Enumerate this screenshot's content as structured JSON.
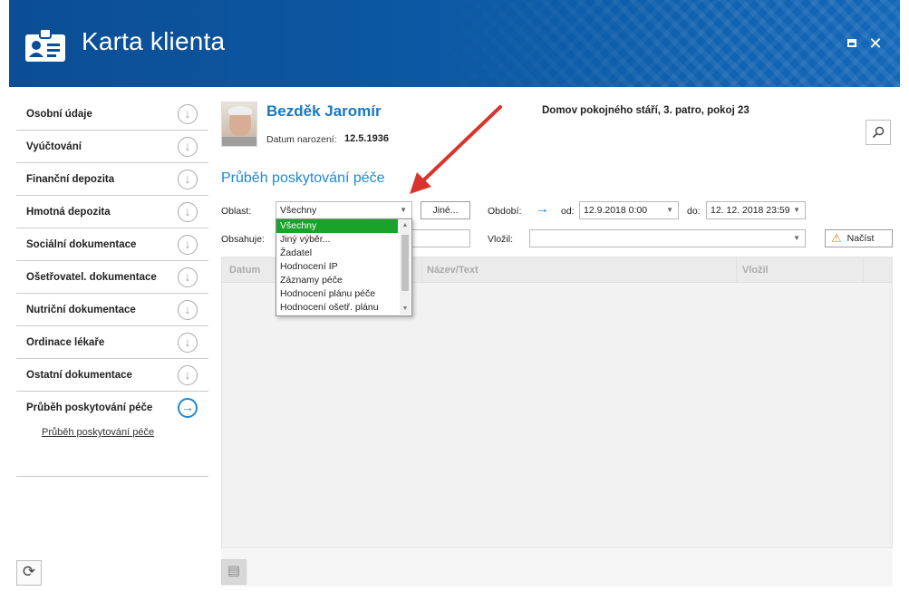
{
  "header": {
    "title": "Karta klienta",
    "bg_color": "#0b4e95"
  },
  "sidebar": {
    "items": [
      {
        "label": "Osobní údaje",
        "icon": "arrow-down-circle-icon"
      },
      {
        "label": "Vyúčtování",
        "icon": "arrow-down-circle-icon"
      },
      {
        "label": "Finanční depozita",
        "icon": "arrow-down-circle-icon"
      },
      {
        "label": "Hmotná depozita",
        "icon": "arrow-down-circle-icon"
      },
      {
        "label": "Sociální dokumentace",
        "icon": "arrow-down-circle-icon"
      },
      {
        "label": "Ošetřovatel. dokumentace",
        "icon": "arrow-down-circle-icon"
      },
      {
        "label": "Nutriční dokumentace",
        "icon": "arrow-down-circle-icon"
      },
      {
        "label": "Ordinace lékaře",
        "icon": "arrow-down-circle-icon"
      },
      {
        "label": "Ostatní dokumentace",
        "icon": "arrow-down-circle-icon"
      },
      {
        "label": "Průběh poskytování péče",
        "icon": "arrow-right-circle-icon",
        "active": true
      }
    ],
    "sub_link": "Průběh poskytování péče"
  },
  "client": {
    "name": "Bezděk Jaromír",
    "dob_label": "Datum narození:",
    "dob_value": "12.5.1936",
    "address": "Domov pokojného stáří, 3. patro, pokoj 23"
  },
  "section": {
    "title": "Průběh poskytování péče"
  },
  "filters": {
    "oblast_label": "Oblast:",
    "oblast_value": "Všechny",
    "jine_button": "Jiné...",
    "obdobi_label": "Období:",
    "od_label": "od:",
    "od_value": "12.9.2018 0:00",
    "do_label": "do:",
    "do_value": "12. 12. 2018 23:59",
    "obsahuje_label": "Obsahuje:",
    "vlozil_label": "Vložil:",
    "vlozil_value": "",
    "nacist_button": "Načíst"
  },
  "table": {
    "columns": [
      "Datum",
      "Název/Text",
      "Vložil"
    ]
  },
  "dropdown": {
    "options": [
      "Všechny",
      "Jiný výběr...",
      "Žadatel",
      "Hodnocení IP",
      "Záznamy péče",
      "Hodnocení plánu péče",
      "Hodnocení ošetř. plánu"
    ],
    "selected_index": 0,
    "selected_color": "#1aa32b"
  },
  "colors": {
    "accent": "#1e87d8",
    "annotation_arrow": "#d9342b"
  }
}
